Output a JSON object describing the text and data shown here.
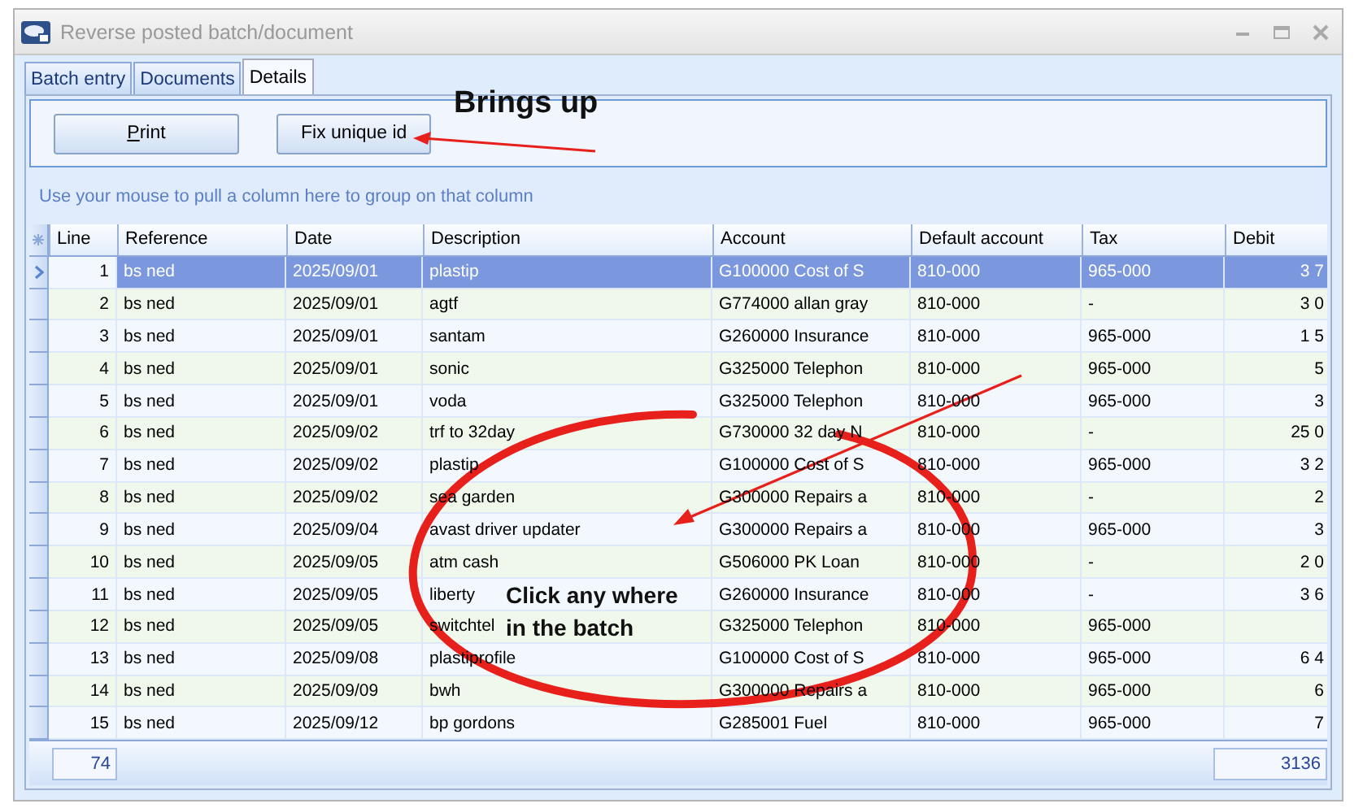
{
  "window": {
    "title": "Reverse posted batch/document"
  },
  "tabs": [
    {
      "label": "Batch entry",
      "selected": false
    },
    {
      "label": "Documents",
      "selected": false
    },
    {
      "label": "Details",
      "selected": true
    }
  ],
  "buttons": [
    "Print",
    "Fix unique id"
  ],
  "group_hint": "Use your mouse to pull a column here to group on that column",
  "table": {
    "columns": [
      "Line",
      "Reference",
      "Date",
      "Description",
      "Account",
      "Default account",
      "Tax",
      "Debit"
    ],
    "rows": [
      {
        "cells": [
          "1",
          "bs ned",
          "2025/09/01",
          "plastip",
          "G100000 Cost of S",
          "810-000",
          "965-000",
          "3 7"
        ],
        "selected": true
      },
      {
        "cells": [
          "2",
          "bs ned",
          "2025/09/01",
          "agtf",
          "G774000 allan gray",
          "810-000",
          "-",
          "3 0"
        ],
        "selected": false
      },
      {
        "cells": [
          "3",
          "bs ned",
          "2025/09/01",
          "santam",
          "G260000 Insurance",
          "810-000",
          "965-000",
          "1 5"
        ],
        "selected": false
      },
      {
        "cells": [
          "4",
          "bs ned",
          "2025/09/01",
          "sonic",
          "G325000 Telephon",
          "810-000",
          "965-000",
          "5"
        ],
        "selected": false
      },
      {
        "cells": [
          "5",
          "bs ned",
          "2025/09/01",
          "voda",
          "G325000 Telephon",
          "810-000",
          "965-000",
          "3"
        ],
        "selected": false
      },
      {
        "cells": [
          "6",
          "bs ned",
          "2025/09/02",
          "trf to 32day",
          "G730000 32 day N",
          "810-000",
          "-",
          "25 0"
        ],
        "selected": false
      },
      {
        "cells": [
          "7",
          "bs ned",
          "2025/09/02",
          "plastip",
          "G100000 Cost of S",
          "810-000",
          "965-000",
          "3 2"
        ],
        "selected": false
      },
      {
        "cells": [
          "8",
          "bs ned",
          "2025/09/02",
          "sea garden",
          "G300000 Repairs a",
          "810-000",
          "-",
          "2"
        ],
        "selected": false
      },
      {
        "cells": [
          "9",
          "bs ned",
          "2025/09/04",
          "avast driver updater",
          "G300000 Repairs a",
          "810-000",
          "965-000",
          "3"
        ],
        "selected": false
      },
      {
        "cells": [
          "10",
          "bs ned",
          "2025/09/05",
          "atm cash",
          "G506000 PK  Loan",
          "810-000",
          "-",
          "2 0"
        ],
        "selected": false
      },
      {
        "cells": [
          "11",
          "bs ned",
          "2025/09/05",
          "liberty",
          "G260000 Insurance",
          "810-000",
          "-",
          "3 6"
        ],
        "selected": false
      },
      {
        "cells": [
          "12",
          "bs ned",
          "2025/09/05",
          "switchtel",
          "G325000 Telephon",
          "810-000",
          "965-000",
          ""
        ],
        "selected": false
      },
      {
        "cells": [
          "13",
          "bs ned",
          "2025/09/08",
          "plastiprofile",
          "G100000 Cost of S",
          "810-000",
          "965-000",
          "6 4"
        ],
        "selected": false
      },
      {
        "cells": [
          "14",
          "bs ned",
          "2025/09/09",
          "bwh",
          "G300000 Repairs a",
          "810-000",
          "965-000",
          "6"
        ],
        "selected": false
      },
      {
        "cells": [
          "15",
          "bs ned",
          "2025/09/12",
          "bp gordons",
          "G285001 Fuel",
          "810-000",
          "965-000",
          "7"
        ],
        "selected": false
      }
    ]
  },
  "footer": {
    "count": "74",
    "debit_total": "3136"
  },
  "annotations": [
    {
      "kind": "arrow-note",
      "text": "Brings up"
    },
    {
      "kind": "circle-note",
      "text": "Click any where in the batch"
    }
  ]
}
